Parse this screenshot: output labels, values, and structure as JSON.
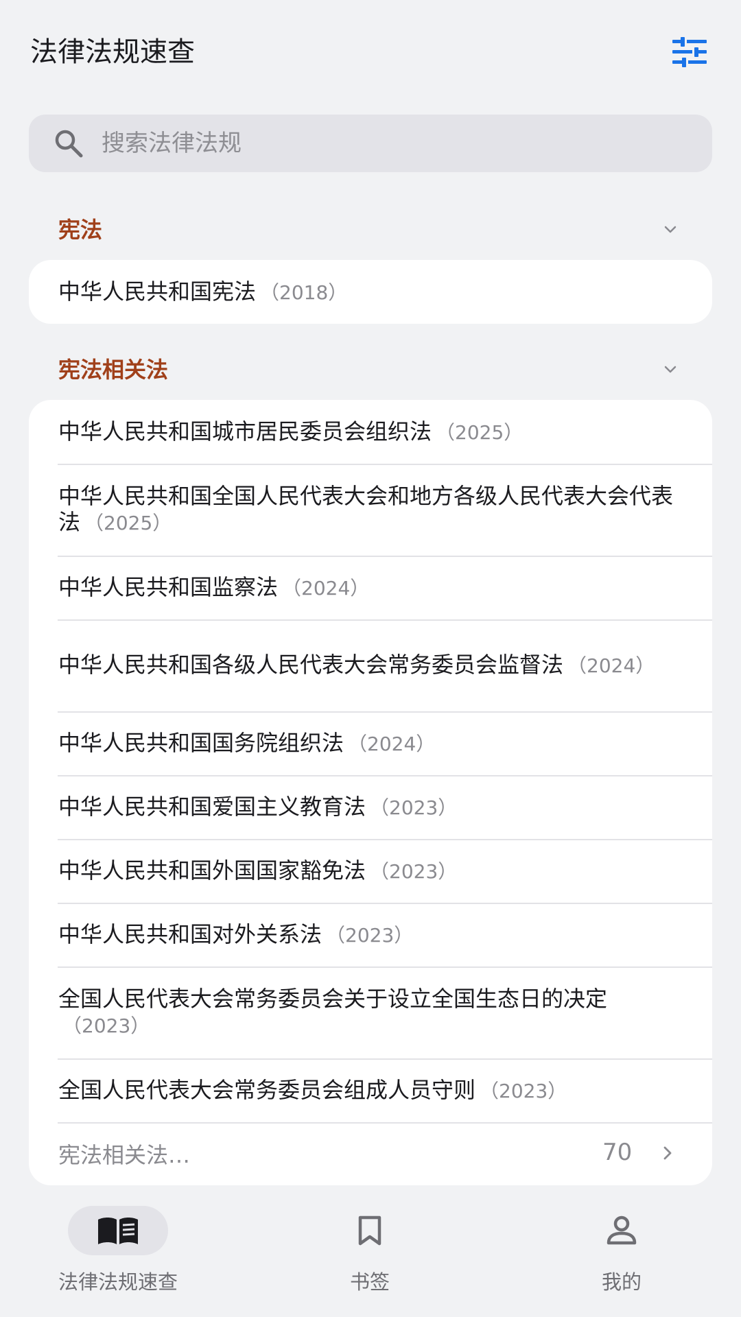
{
  "header": {
    "title": "法律法规速查",
    "filter_icon": "sliders-icon",
    "accent": "#1a73e8"
  },
  "search": {
    "placeholder": "搜索法律法规",
    "value": ""
  },
  "sections": [
    {
      "title": "宪法",
      "title_color": "#a0401a",
      "items": [
        {
          "name": "中华人民共和国宪法",
          "year": "（2018）"
        }
      ]
    },
    {
      "title": "宪法相关法",
      "items": [
        {
          "name": "中华人民共和国城市居民委员会组织法",
          "year": "（2025）"
        },
        {
          "name": "中华人民共和国全国人民代表大会和地方各级人民代表大会代表法",
          "year": "（2025）"
        },
        {
          "name": "中华人民共和国监察法",
          "year": "（2024）"
        },
        {
          "name": "中华人民共和国各级人民代表大会常务委员会监督法",
          "year": "（2024）"
        },
        {
          "name": "中华人民共和国国务院组织法",
          "year": "（2024）"
        },
        {
          "name": "中华人民共和国爱国主义教育法",
          "year": "（2023）"
        },
        {
          "name": "中华人民共和国外国国家豁免法",
          "year": "（2023）"
        },
        {
          "name": "中华人民共和国对外关系法",
          "year": "（2023）"
        },
        {
          "name": "全国人民代表大会常务委员会关于设立全国生态日的决定",
          "year": "（2023）"
        },
        {
          "name": "全国人民代表大会常务委员会组成人员守则",
          "year": "（2023）"
        }
      ],
      "more": {
        "label": "宪法相关法…",
        "count": "70"
      }
    }
  ],
  "bottom_nav": [
    {
      "label": "法律法规速查",
      "icon": "book-open-icon",
      "active": true
    },
    {
      "label": "书签",
      "icon": "bookmark-icon",
      "active": false
    },
    {
      "label": "我的",
      "icon": "person-icon",
      "active": false
    }
  ]
}
